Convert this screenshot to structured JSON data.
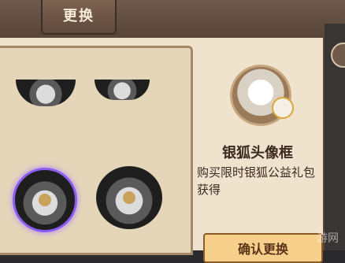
{
  "header": {
    "title": "更换"
  },
  "detail": {
    "name": "银狐头像框",
    "description": "购买限时银狐公益礼包获得"
  },
  "actions": {
    "confirm_label": "确认更换"
  },
  "watermark": "游网",
  "colors": {
    "panel": "#efe3cd",
    "list_bg": "#e5d6b9",
    "selected_glow": "#8a5cf0",
    "button": "#f6d08a"
  }
}
